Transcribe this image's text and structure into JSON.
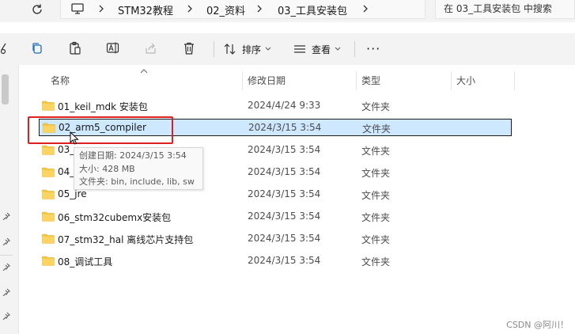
{
  "address_bar": {
    "breadcrumbs": [
      "STM32教程",
      "02_资料",
      "03_工具安装包"
    ],
    "search_placeholder": "在 03_工具安装包 中搜索"
  },
  "toolbar": {
    "sort_label": "排序",
    "view_label": "查看",
    "more_label": "···"
  },
  "columns": {
    "name": "名称",
    "modified": "修改日期",
    "type": "类型",
    "size": "大小"
  },
  "files": [
    {
      "name": "01_keil_mdk 安装包",
      "modified": "2024/4/24 9:33",
      "type": "文件夹"
    },
    {
      "name": "02_arm5_compiler",
      "modified": "2024/3/15 3:54",
      "type": "文件夹",
      "selected": true
    },
    {
      "name": "03_",
      "modified": "2024/3/15 3:54",
      "type": "文件夹"
    },
    {
      "name": "04_",
      "modified": "2024/3/15 3:54",
      "type": "文件夹"
    },
    {
      "name": "05_jre",
      "modified": "2024/3/15 3:54",
      "type": "文件夹"
    },
    {
      "name": "06_stm32cubemx安装包",
      "modified": "2024/3/15 3:54",
      "type": "文件夹"
    },
    {
      "name": "07_stm32_hal 离线芯片支持包",
      "modified": "2024/3/15 3:54",
      "type": "文件夹"
    },
    {
      "name": "08_调试工具",
      "modified": "2024/3/15 3:54",
      "type": "文件夹"
    }
  ],
  "tooltip": {
    "created": "创建日期: 2024/3/15 3:54",
    "size": "大小: 428 MB",
    "contents": "文件夹: bin, include, lib, sw"
  },
  "watermark": "CSDN @阿川！",
  "colors": {
    "selection_bg": "#cde8ff",
    "annotation_red": "#e02020",
    "folder_yellow": "#f8c843"
  }
}
